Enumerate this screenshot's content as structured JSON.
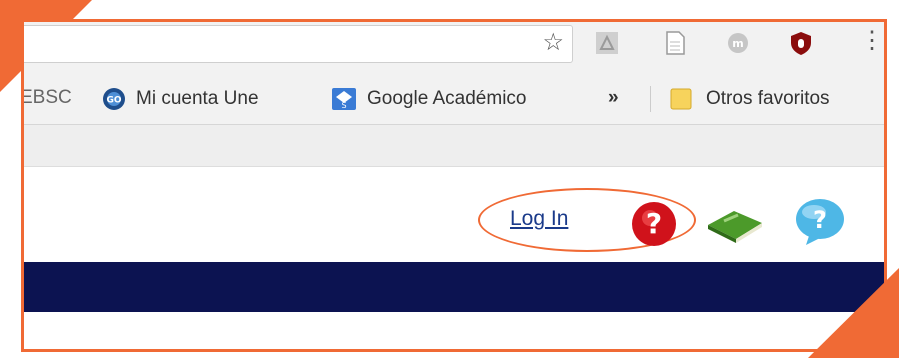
{
  "bookmarks": {
    "ebsco_label": "EBSC",
    "mi_cuenta_label": "Mi cuenta Une",
    "google_academico_label": "Google Académico",
    "more_label": "»",
    "otros_label": "Otros favoritos"
  },
  "toolbar": {
    "star_glyph": "☆",
    "menu_glyph": "⋮"
  },
  "header": {
    "login_label": "Log In"
  },
  "colors": {
    "accent": "#f06a35",
    "navbar": "#0c1351",
    "link": "#1a3a8a"
  }
}
